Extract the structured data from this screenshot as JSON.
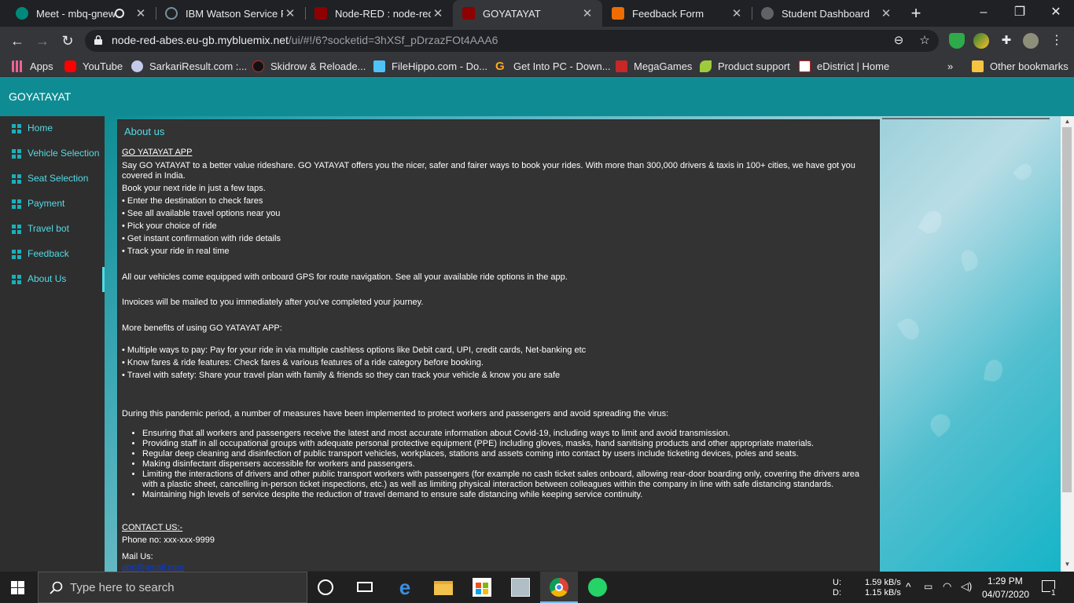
{
  "browser": {
    "tabs": [
      {
        "title": "Meet - mbq-gnew-",
        "active": false
      },
      {
        "title": "IBM Watson Service Pag",
        "active": false
      },
      {
        "title": "Node-RED : node-red-a",
        "active": false
      },
      {
        "title": "GOYATAYAT",
        "active": true
      },
      {
        "title": "Feedback Form",
        "active": false
      },
      {
        "title": "Student Dashboard",
        "active": false
      }
    ],
    "url_host": "node-red-abes.eu-gb.mybluemix.net",
    "url_path": "/ui/#!/6?socketid=3hXSf_pDrzazFOt4AAA6",
    "bookmarks": [
      "Apps",
      "YouTube",
      "SarkariResult.com :...",
      "Skidrow & Reloade...",
      "FileHippo.com - Do...",
      "Get Into PC - Down...",
      "MegaGames",
      "Product support",
      "eDistrict | Home"
    ],
    "overflow": "»",
    "other_bookmarks": "Other bookmarks"
  },
  "app": {
    "title": "GOYATAYAT",
    "nav": [
      "Home",
      "Vehicle Selection",
      "Seat Selection",
      "Payment",
      "Travel bot",
      "Feedback",
      "About Us"
    ],
    "active_nav": "About Us",
    "accent": "#53dbe6",
    "header_color": "#0f8c93"
  },
  "about": {
    "card_title": "About us",
    "app_heading": "GO YATAYAT APP",
    "intro": "Say GO YATAYAT to a better value rideshare. GO YATAYAT offers you the nicer, safer and fairer ways to book your rides. With more than 300,000 drivers & taxis in 100+ cities, we have got you covered in India.",
    "book_line": "Book your next ride in just a few taps.",
    "steps": [
      "• Enter the destination to check fares",
      "• See all available travel options near you",
      "• Pick your choice of ride",
      "• Get instant confirmation with ride details",
      "• Track your ride in real time"
    ],
    "gps_line": "All our vehicles come equipped with onboard GPS for route navigation. See all your available ride options in the app.",
    "invoice_line": "Invoices will be mailed to you immediately after you've completed your journey.",
    "benefits_heading": "More benefits of using  GO YATAYAT APP:",
    "benefits": [
      "• Multiple ways to pay: Pay for your ride in via multiple cashless options like Debit card, UPI, credit cards, Net-banking etc",
      "• Know fares & ride features: Check fares & various features of a ride category before booking.",
      "• Travel with safety: Share your travel plan with family & friends so they can track your vehicle & know you are safe"
    ],
    "pandemic_intro": "During this pandemic period, a number of measures have been implemented to protect workers and passengers and avoid spreading the virus:",
    "measures": [
      "Ensuring that all workers and passengers receive the latest and most accurate information about Covid-19, including ways to limit and avoid transmission.",
      "Providing staff in all occupational groups with adequate personal protective equipment (PPE) including gloves, masks, hand sanitising products and other appropriate materials.",
      "Regular deep cleaning and disinfection of public transport vehicles, workplaces, stations and assets coming into contact by users include ticketing devices, poles and seats.",
      "Making disinfectant dispensers accessible for workers and passengers.",
      "Limiting the interactions of drivers and other public transport workers with passengers (for example no cash ticket sales onboard, allowing rear-door boarding only, covering the drivers area with a plastic sheet, cancelling in-person ticket inspections, etc.) as well as limiting physical interaction between colleagues within the company in line with safe distancing standards.",
      "Maintaining high levels of service despite the reduction of travel demand to ensure safe distancing while keeping service continuity."
    ],
    "contact_heading": "CONTACT US:-",
    "phone": "Phone no: xxx-xxx-9999",
    "mail_label": "Mail Us:",
    "mail": "abc@gmail.com"
  },
  "taskbar": {
    "search_placeholder": "Type here to search",
    "net_up_label": "U:",
    "net_down_label": "D:",
    "net_up": "1.59 kB/s",
    "net_down": "1.15 kB/s",
    "time": "1:29 PM",
    "date": "04/07/2020",
    "notifications": "1"
  }
}
